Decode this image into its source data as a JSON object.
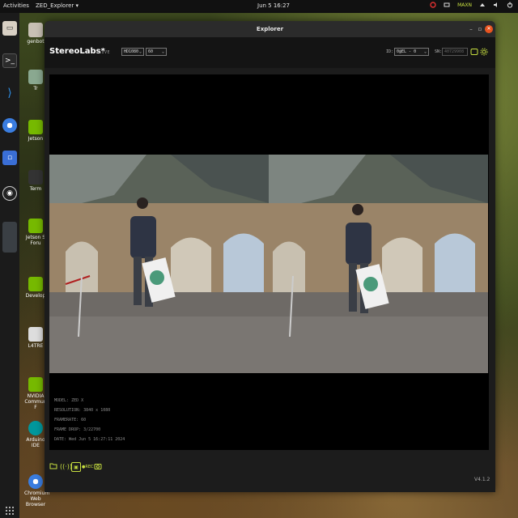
{
  "topbar": {
    "activities": "Activities",
    "app_menu": "ZED_Explorer",
    "clock": "Jun 5  16:27",
    "tray_badge": "MAXN"
  },
  "desktop_icons": [
    {
      "label": "genbot"
    },
    {
      "label": "Tr"
    },
    {
      "label": "Jetson"
    },
    {
      "label": "Term"
    },
    {
      "label": "Jetson S Foru"
    },
    {
      "label": "Develop"
    },
    {
      "label": "L4TRE"
    },
    {
      "label": "NVIDIA Commun F"
    },
    {
      "label": "Arduino IDE"
    },
    {
      "label": "Chromium Web Browser"
    }
  ],
  "window": {
    "title": "Explorer"
  },
  "app": {
    "brand": "StereoLabs*",
    "live": "LIVE",
    "resolution_value": "HD1080",
    "fps_value": "60",
    "id_label": "ID:",
    "id_value": "0@EL - 0",
    "sn_label": "SN:",
    "sn_value": "40729908"
  },
  "info": {
    "model": "MODEL: ZED X",
    "resolution": "RESOLUTION: 3840 x 1080",
    "framerate": "FRAMERATE: 60",
    "frame_drop": "FRAME DROP: 3/22700",
    "date": "DATE: Wed Jun 5 16:27:11 2024"
  },
  "footer": {
    "rec_label": "REC",
    "version": "V4.1.2"
  },
  "colors": {
    "accent": "#c8e040",
    "close": "#e95420",
    "window_bg": "#1c1c1c",
    "viewer_bg": "#000000"
  },
  "icons": [
    "files-icon",
    "terminal-icon",
    "vscode-icon",
    "chromium-icon",
    "editor-icon",
    "obs-icon",
    "folder-icon",
    "broadcast-icon",
    "rec-icon",
    "camera-icon",
    "settings-icon",
    "record-button-icon"
  ]
}
